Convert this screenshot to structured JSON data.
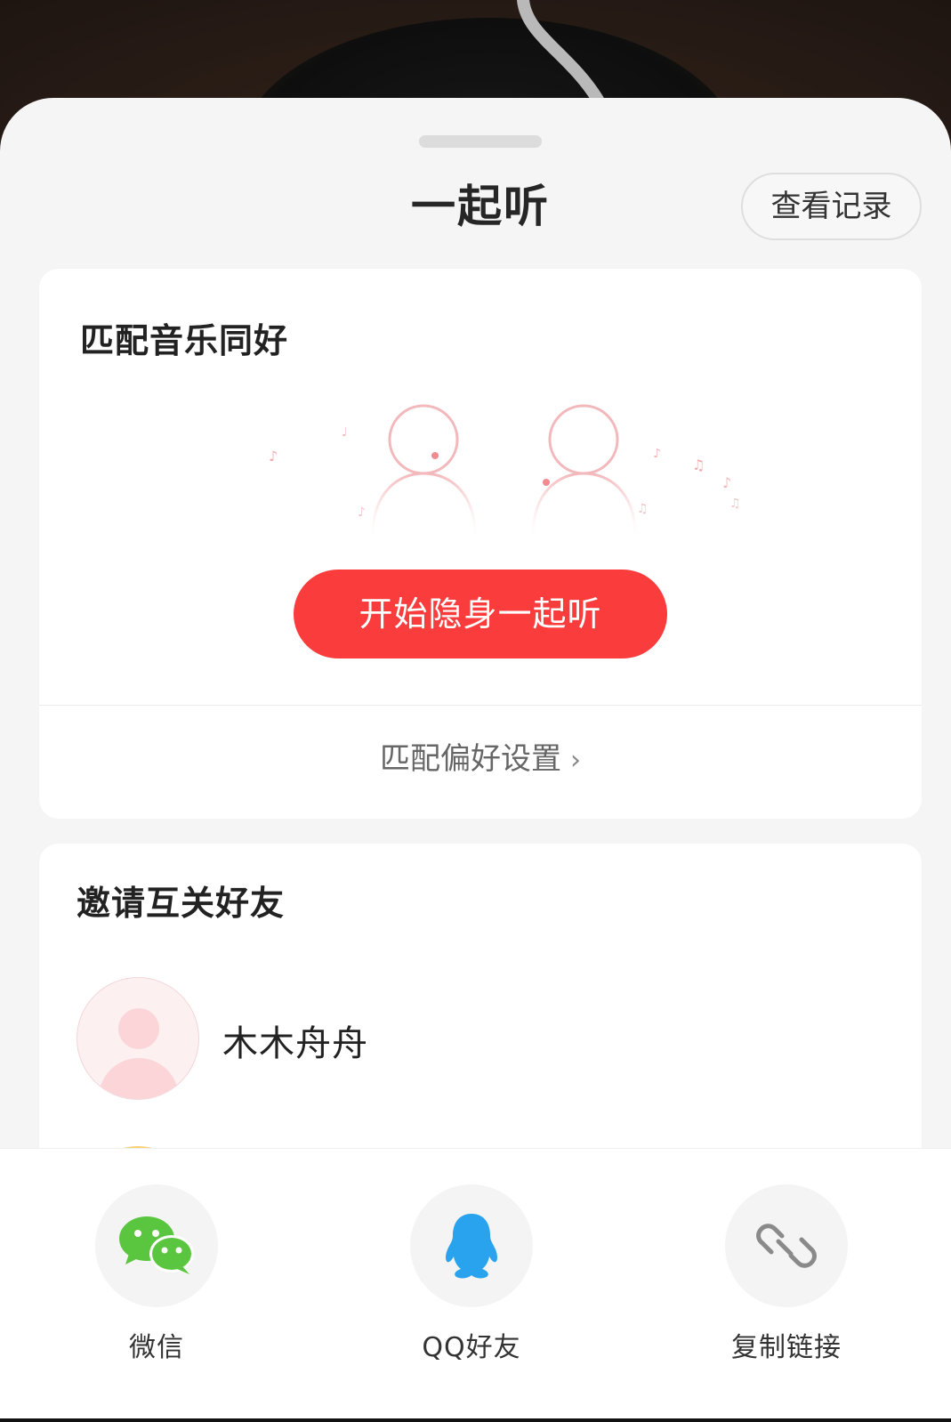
{
  "sheet": {
    "title": "一起听",
    "record_button": "查看记录"
  },
  "match_card": {
    "title": "匹配音乐同好",
    "start_button": "开始隐身一起听",
    "preference_link": "匹配偏好设置"
  },
  "invite_card": {
    "title": "邀请互关好友",
    "friends": [
      {
        "name": "木木舟舟"
      }
    ]
  },
  "share": {
    "items": [
      {
        "label": "微信",
        "icon": "wechat-icon"
      },
      {
        "label": "QQ好友",
        "icon": "qq-icon"
      },
      {
        "label": "复制链接",
        "icon": "link-icon"
      }
    ]
  },
  "colors": {
    "accent": "#fb3c3c",
    "wechat": "#5ac63f",
    "qq": "#2aa3ee",
    "background": "#f5f5f5"
  }
}
